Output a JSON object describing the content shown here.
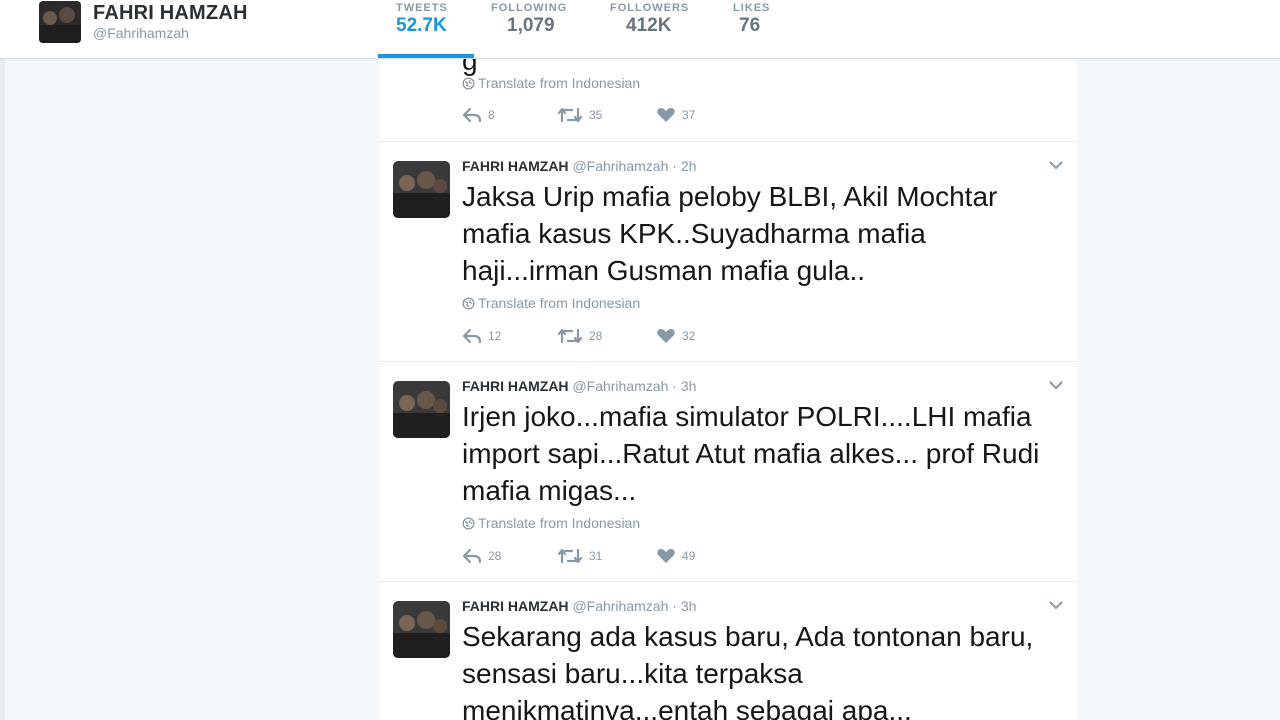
{
  "profile": {
    "name": "FAHRI HAMZAH",
    "handle": "@Fahrihamzah"
  },
  "stats": [
    {
      "label": "TWEETS",
      "value": "52.7K",
      "active": true
    },
    {
      "label": "FOLLOWING",
      "value": "1,079",
      "active": false
    },
    {
      "label": "FOLLOWERS",
      "value": "412K",
      "active": false
    },
    {
      "label": "LIKES",
      "value": "76",
      "active": false
    }
  ],
  "partial_tweet": {
    "text_fragment": "g",
    "translate": "Translate from Indonesian",
    "replies": "8",
    "retweets": "35",
    "likes": "37"
  },
  "tweets": [
    {
      "fullname": "FAHRI HAMZAH",
      "handle": "@Fahrihamzah",
      "dot": "·",
      "time": "2h",
      "text": "Jaksa Urip mafia peloby BLBI, Akil Mochtar mafia kasus KPK..Suyadharma mafia haji...irman Gusman mafia gula..",
      "translate": "Translate from Indonesian",
      "replies": "12",
      "retweets": "28",
      "likes": "32"
    },
    {
      "fullname": "FAHRI HAMZAH",
      "handle": "@Fahrihamzah",
      "dot": "·",
      "time": "3h",
      "text": "Irjen joko...mafia simulator POLRI....LHI mafia import sapi...Ratut Atut mafia alkes... prof Rudi mafia migas...",
      "translate": "Translate from Indonesian",
      "replies": "28",
      "retweets": "31",
      "likes": "49"
    },
    {
      "fullname": "FAHRI HAMZAH",
      "handle": "@Fahrihamzah",
      "dot": "·",
      "time": "3h",
      "text": "Sekarang ada kasus baru, Ada tontonan baru, sensasi baru...kita terpaksa menikmatinya...entah sebagai apa...",
      "translate": "",
      "replies": "",
      "retweets": "",
      "likes": ""
    }
  ],
  "colors": {
    "accent": "#1b95e0",
    "muted": "#8899a6",
    "text": "#14171a",
    "background": "#f5f8fa"
  },
  "icons": [
    "reply-icon",
    "retweet-icon",
    "like-icon",
    "globe-icon",
    "chevron-down-icon"
  ]
}
